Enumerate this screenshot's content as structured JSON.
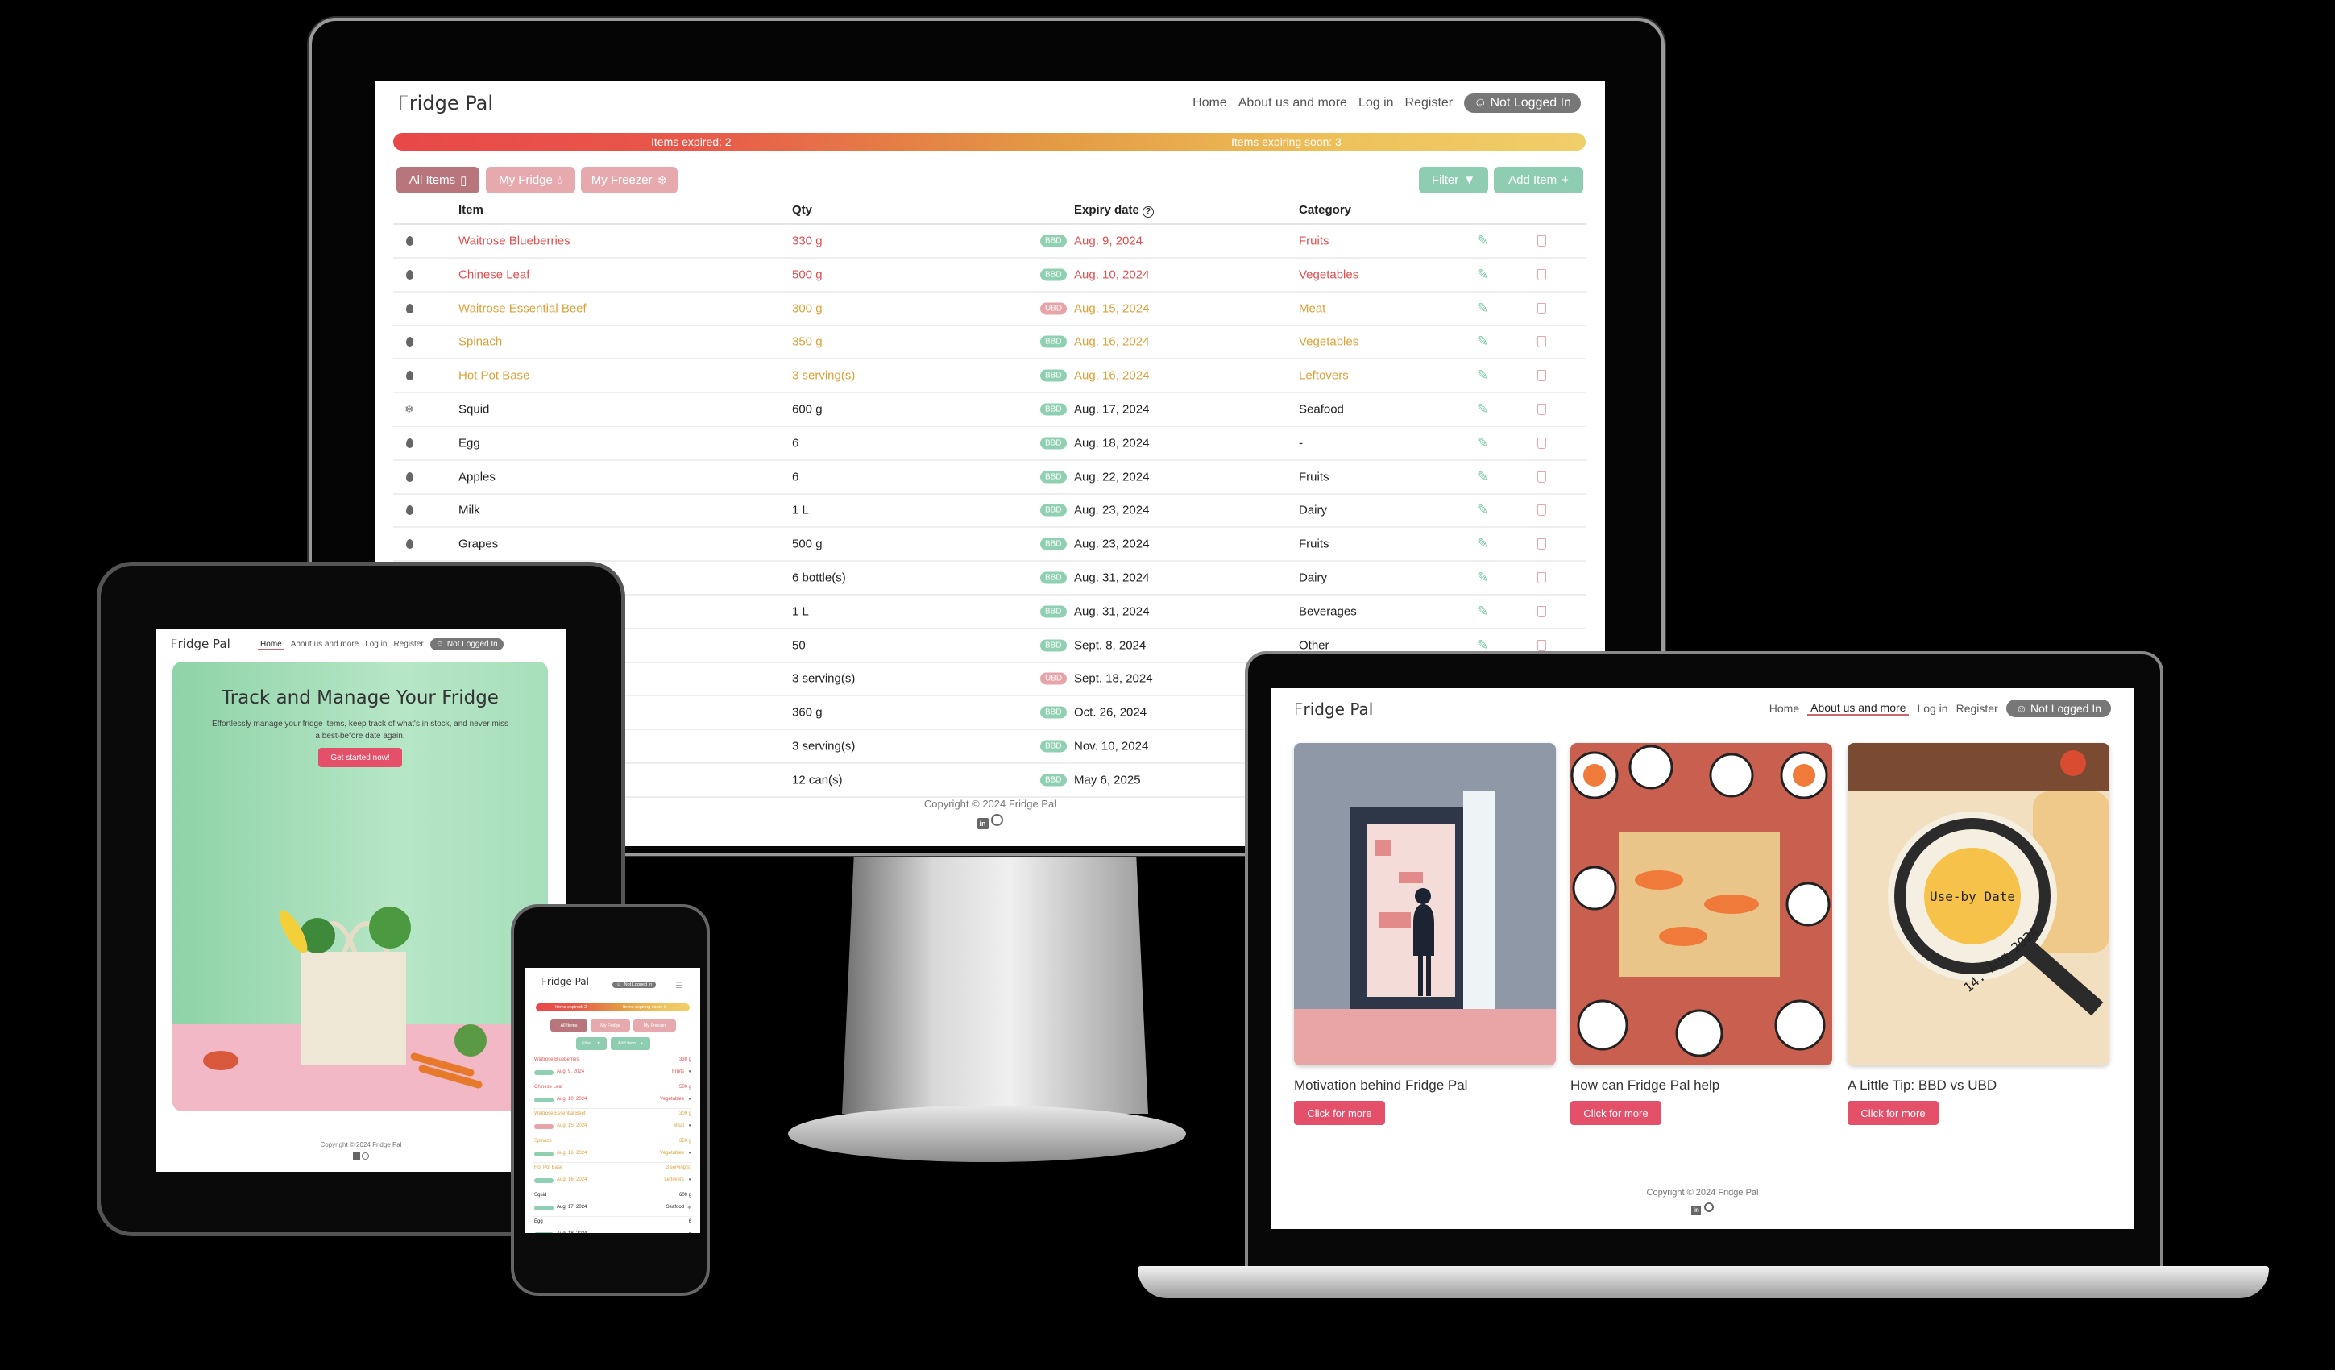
{
  "app": {
    "logo_f": "F",
    "logo_rest": "ridge Pal"
  },
  "nav": {
    "home": "Home",
    "about": "About us and more",
    "login": "Log in",
    "register": "Register",
    "status": "Not Logged In"
  },
  "status_bar": {
    "expired": "Items expired: 2",
    "expiring": "Items expiring soon: 3"
  },
  "toolbar": {
    "all_items": "All Items",
    "my_fridge": "My Fridge",
    "my_freezer": "My Freezer",
    "filter": "Filter",
    "add_item": "Add Item"
  },
  "table": {
    "headers": {
      "item": "Item",
      "qty": "Qty",
      "expiry": "Expiry date",
      "category": "Category"
    },
    "rows": [
      {
        "loc": "fridge",
        "item": "Waitrose Blueberries",
        "qty": "330 g",
        "type": "BBD",
        "date": "Aug. 9, 2024",
        "category": "Fruits",
        "state": "expired"
      },
      {
        "loc": "fridge",
        "item": "Chinese Leaf",
        "qty": "500 g",
        "type": "BBD",
        "date": "Aug. 10, 2024",
        "category": "Vegetables",
        "state": "expired"
      },
      {
        "loc": "fridge",
        "item": "Waitrose Essential Beef",
        "qty": "300 g",
        "type": "UBD",
        "date": "Aug. 15, 2024",
        "category": "Meat",
        "state": "soon"
      },
      {
        "loc": "fridge",
        "item": "Spinach",
        "qty": "350 g",
        "type": "BBD",
        "date": "Aug. 16, 2024",
        "category": "Vegetables",
        "state": "soon"
      },
      {
        "loc": "fridge",
        "item": "Hot Pot Base",
        "qty": "3 serving(s)",
        "type": "BBD",
        "date": "Aug. 16, 2024",
        "category": "Leftovers",
        "state": "soon"
      },
      {
        "loc": "freezer",
        "item": "Squid",
        "qty": "600 g",
        "type": "BBD",
        "date": "Aug. 17, 2024",
        "category": "Seafood",
        "state": "ok"
      },
      {
        "loc": "fridge",
        "item": "Egg",
        "qty": "6",
        "type": "BBD",
        "date": "Aug. 18, 2024",
        "category": "-",
        "state": "ok"
      },
      {
        "loc": "fridge",
        "item": "Apples",
        "qty": "6",
        "type": "BBD",
        "date": "Aug. 22, 2024",
        "category": "Fruits",
        "state": "ok"
      },
      {
        "loc": "fridge",
        "item": "Milk",
        "qty": "1 L",
        "type": "BBD",
        "date": "Aug. 23, 2024",
        "category": "Dairy",
        "state": "ok"
      },
      {
        "loc": "fridge",
        "item": "Grapes",
        "qty": "500 g",
        "type": "BBD",
        "date": "Aug. 23, 2024",
        "category": "Fruits",
        "state": "ok"
      },
      {
        "loc": "",
        "item": "",
        "qty": "6 bottle(s)",
        "type": "BBD",
        "date": "Aug. 31, 2024",
        "category": "Dairy",
        "state": "ok"
      },
      {
        "loc": "",
        "item": "",
        "qty": "1 L",
        "type": "BBD",
        "date": "Aug. 31, 2024",
        "category": "Beverages",
        "state": "ok"
      },
      {
        "loc": "",
        "item": "",
        "qty": "50",
        "type": "BBD",
        "date": "Sept. 8, 2024",
        "category": "Other",
        "state": "ok"
      },
      {
        "loc": "",
        "item": "",
        "qty": "3 serving(s)",
        "type": "UBD",
        "date": "Sept. 18, 2024",
        "category": "",
        "state": "ok"
      },
      {
        "loc": "",
        "item": "",
        "qty": "360 g",
        "type": "BBD",
        "date": "Oct. 26, 2024",
        "category": "",
        "state": "ok"
      },
      {
        "loc": "",
        "item": "",
        "qty": "3 serving(s)",
        "type": "BBD",
        "date": "Nov. 10, 2024",
        "category": "",
        "state": "ok"
      },
      {
        "loc": "",
        "item": "",
        "qty": "12 can(s)",
        "type": "BBD",
        "date": "May 6, 2025",
        "category": "",
        "state": "ok"
      }
    ]
  },
  "footer": {
    "copyright": "Copyright © 2024 Fridge Pal"
  },
  "hero": {
    "title": "Track and Manage Your Fridge",
    "text": "Effortlessly manage your fridge items, keep track of what's in stock, and never miss a best-before date again.",
    "cta": "Get started now!"
  },
  "about": {
    "cards": [
      {
        "title": "Motivation behind Fridge Pal",
        "button": "Click for more"
      },
      {
        "title": "How can Fridge Pal help",
        "button": "Click for more"
      },
      {
        "title": "A Little Tip: BBD vs UBD",
        "button": "Click for more"
      }
    ],
    "illustration_text": {
      "label": "Use-by Date",
      "date": "14. Aug 2024"
    }
  },
  "colors": {
    "expired": "#e14f4f",
    "soon": "#dba23a",
    "bbd": "#8fcfb2",
    "ubd": "#e8a3a8",
    "accent": "#e4506a",
    "mint": "#8ecdb2",
    "rose": "#e6aaae"
  }
}
